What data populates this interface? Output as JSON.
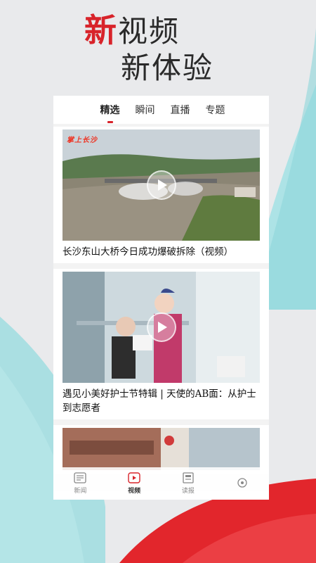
{
  "headline": {
    "accent": "新",
    "line1_rest": "视频",
    "line2": "新体验"
  },
  "tabs": [
    {
      "label": "精选",
      "active": true
    },
    {
      "label": "瞬间",
      "active": false
    },
    {
      "label": "直播",
      "active": false
    },
    {
      "label": "专题",
      "active": false
    }
  ],
  "cards": [
    {
      "title": "长沙东山大桥今日成功爆破拆除（视频）",
      "watermark": "掌上长沙",
      "has_play": true
    },
    {
      "title": "遇见小美好护士节特辑 | 天使的AB面：从护士到志愿者",
      "has_play": true
    },
    {
      "title": "",
      "has_play": false
    }
  ],
  "bottom_nav": [
    {
      "label": "新闻",
      "icon": "news-icon",
      "active": false
    },
    {
      "label": "视频",
      "icon": "video-play-icon",
      "active": true
    },
    {
      "label": "读报",
      "icon": "newspaper-icon",
      "active": false
    },
    {
      "label": "",
      "icon": "profile-icon",
      "active": false
    }
  ],
  "colors": {
    "accent": "#d8232a",
    "teal_shape": "#9fdde0",
    "red_shape": "#e2262c"
  }
}
